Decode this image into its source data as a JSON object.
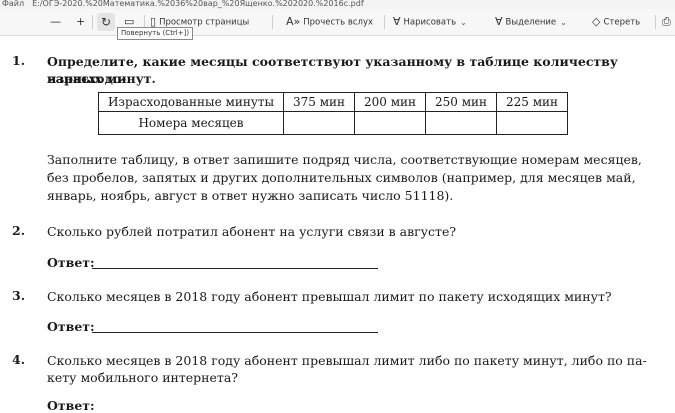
{
  "address_bar": {
    "label": "Файл",
    "path": "E:/ОГЭ-2020.%20Математика.%2036%20вар_%20Ященко.%202020.%2016с.pdf"
  },
  "toolbar": {
    "zoom_out": "—",
    "zoom_in": "+",
    "view_page": "Просмотр страницы",
    "read_aloud": "Прочесть вслух",
    "draw": "Нарисовать",
    "highlight": "Выделение",
    "erase": "Стереть",
    "tooltip": "Повернуть (Ctrl+])"
  },
  "document": {
    "q1": {
      "number": "1.",
      "line1": "Определите, какие месяцы соответствуют указанному в таблице количеству израсходо-",
      "line2": "ванных минут.",
      "table": {
        "header": [
          "Израсходованные минуты",
          "375 мин",
          "200 мин",
          "250 мин",
          "225 мин"
        ],
        "row_label": "Номера месяцев"
      },
      "instr1": "Заполните таблицу, в ответ запишите подряд числа, соответствующие номерам месяцев,",
      "instr2": "без пробелов, запятых и других дополнительных символов (например, для месяцев май,",
      "instr3": "январь, ноябрь, август в ответ нужно записать число 51118)."
    },
    "q2": {
      "number": "2.",
      "text": "Сколько рублей потратил абонент на услуги связи в августе?",
      "answer_label": "Ответ:"
    },
    "q3": {
      "number": "3.",
      "text": "Сколько месяцев в 2018 году абонент превышал лимит по пакету исходящих минут?",
      "answer_label": "Ответ:"
    },
    "q4": {
      "number": "4.",
      "line1": "Сколько месяцев в 2018 году абонент превышал лимит либо по пакету минут, либо по па-",
      "line2": "кету мобильного интернета?",
      "answer_label": "Ответ:"
    }
  }
}
